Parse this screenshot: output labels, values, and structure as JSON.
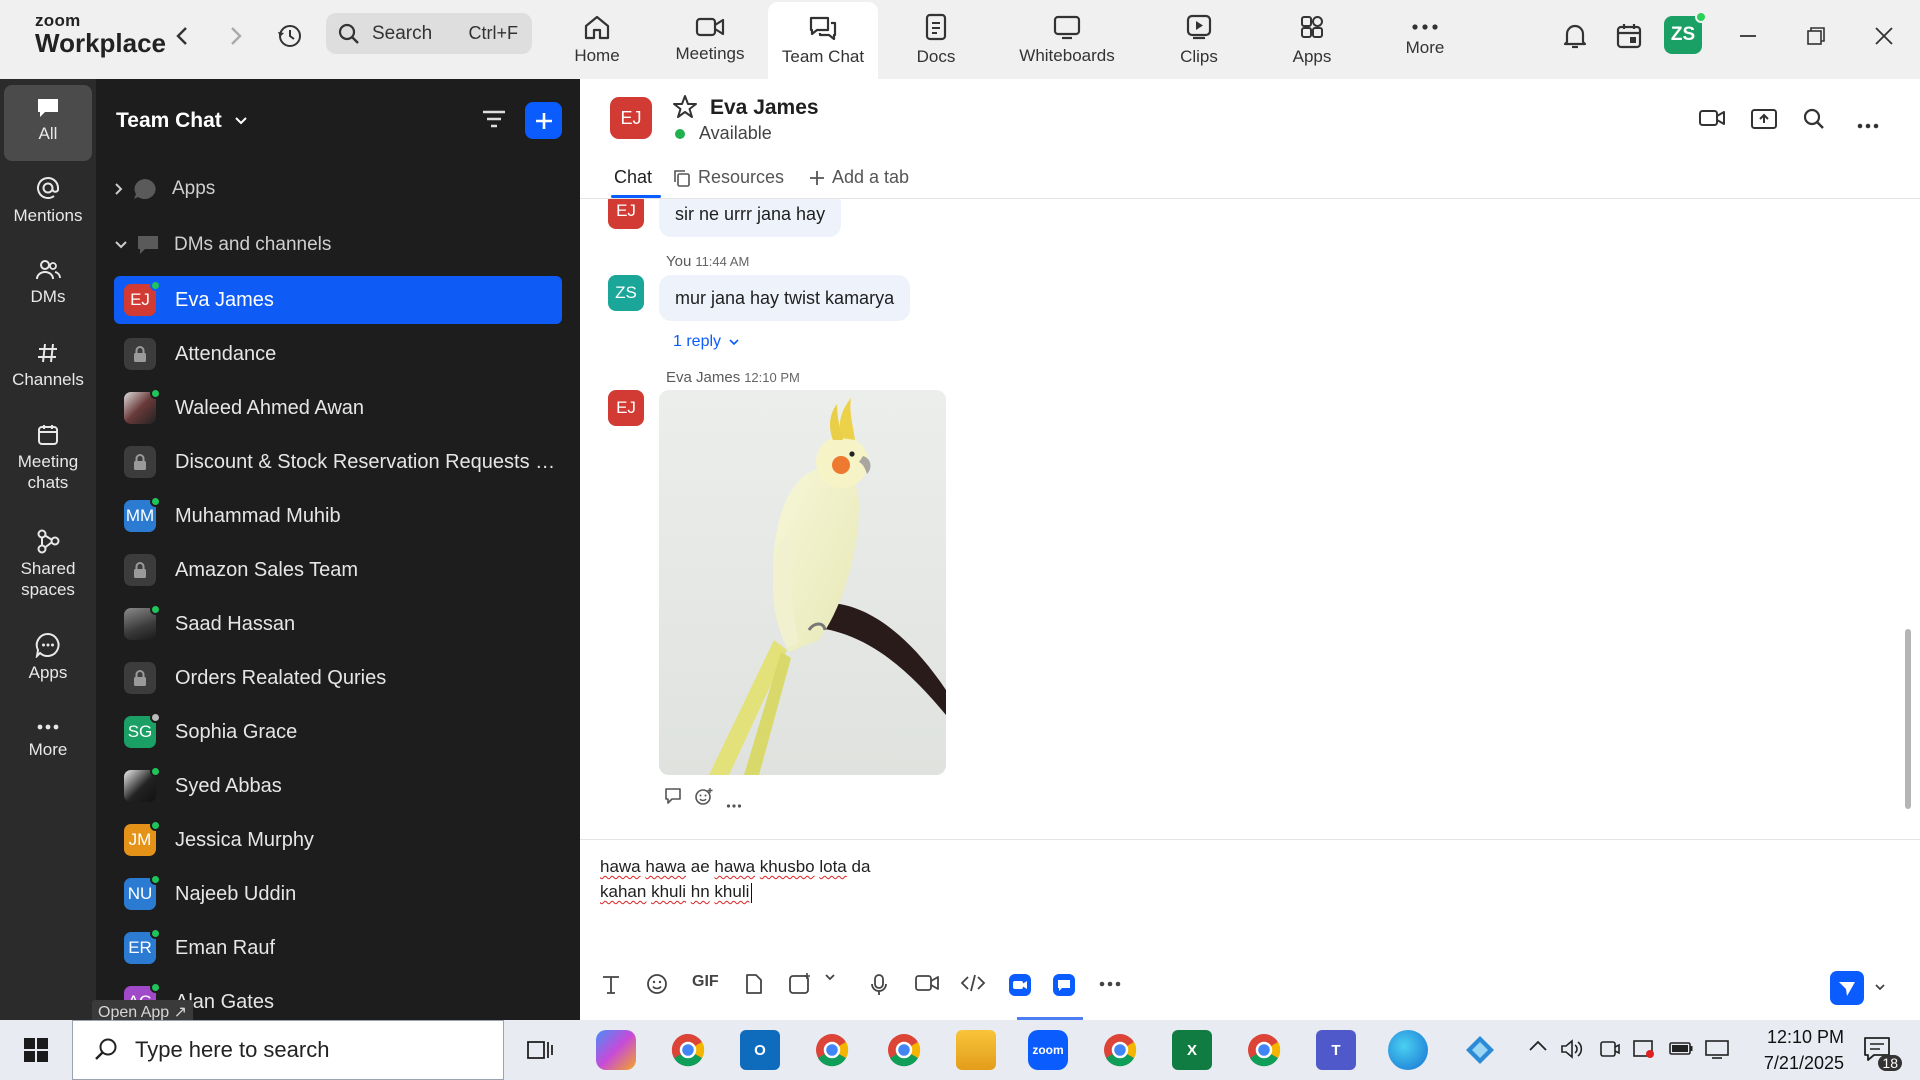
{
  "app": {
    "logo_top": "zoom",
    "logo_bottom": "Workplace"
  },
  "topbar": {
    "search_label": "Search",
    "search_shortcut": "Ctrl+F",
    "tabs": [
      {
        "label": "Home",
        "icon": "home-icon"
      },
      {
        "label": "Meetings",
        "icon": "video-icon"
      },
      {
        "label": "Team Chat",
        "icon": "chat-icon",
        "active": true
      },
      {
        "label": "Docs",
        "icon": "doc-icon"
      },
      {
        "label": "Whiteboards",
        "icon": "whiteboard-icon"
      },
      {
        "label": "Clips",
        "icon": "clips-icon"
      },
      {
        "label": "Apps",
        "icon": "apps-icon"
      },
      {
        "label": "More",
        "icon": "more-icon"
      }
    ],
    "user_initials": "ZS"
  },
  "rail": [
    {
      "label": "All",
      "icon": "chat-bubble-icon",
      "active": true
    },
    {
      "label": "Mentions",
      "icon": "at-icon"
    },
    {
      "label": "DMs",
      "icon": "people-icon"
    },
    {
      "label": "Channels",
      "icon": "hash-icon"
    },
    {
      "label_line1": "Meeting",
      "label_line2": "chats",
      "icon": "calendar-icon"
    },
    {
      "label_line1": "Shared",
      "label_line2": "spaces",
      "icon": "shared-icon"
    },
    {
      "label": "Apps",
      "icon": "apps-bubble-icon"
    },
    {
      "label": "More",
      "icon": "more-icon"
    }
  ],
  "sidebar": {
    "title": "Team Chat",
    "sections": {
      "apps": "Apps",
      "dms": "DMs and channels"
    },
    "items": [
      {
        "name": "Eva James",
        "initials": "EJ",
        "color": "#d13b33",
        "online": true,
        "active": true
      },
      {
        "name": "Attendance",
        "lock": true
      },
      {
        "name": "Waleed Ahmed Awan",
        "initials": "",
        "color": "#5a4a48",
        "online": true,
        "photo": true
      },
      {
        "name": "Discount & Stock Reservation Requests O...",
        "lock": true
      },
      {
        "name": "Muhammad Muhib",
        "initials": "MM",
        "color": "#2b7bd3",
        "online": true
      },
      {
        "name": "Amazon Sales Team",
        "lock": true
      },
      {
        "name": "Saad Hassan",
        "initials": "",
        "color": "#4a4a4a",
        "online": true,
        "photo": true
      },
      {
        "name": "Orders Realated Quries",
        "lock": true
      },
      {
        "name": "Sophia Grace",
        "initials": "SG",
        "color": "#1aa065",
        "away": true
      },
      {
        "name": "Syed Abbas",
        "initials": "",
        "color": "#333333",
        "online": true,
        "photo": true
      },
      {
        "name": "Jessica Murphy",
        "initials": "JM",
        "color": "#e59318",
        "online": true
      },
      {
        "name": "Najeeb Uddin",
        "initials": "NU",
        "color": "#2b7bd3",
        "online": true
      },
      {
        "name": "Eman Rauf",
        "initials": "ER",
        "color": "#2b7bd3",
        "online": true
      },
      {
        "name": "Alan Gates",
        "initials": "AG",
        "color": "#a04ac9",
        "online": true
      }
    ],
    "open_app": "Open App ↗"
  },
  "chat": {
    "contact_name": "Eva James",
    "contact_initials": "EJ",
    "status": "Available",
    "tabs": {
      "chat": "Chat",
      "resources": "Resources",
      "add": "Add a tab"
    },
    "messages": [
      {
        "sender_initials": "EJ",
        "text": "sir ne urrr jana hay"
      },
      {
        "sender": "You",
        "time": "11:44 AM",
        "sender_initials": "ZS",
        "text": "mur jana hay twist kamarya",
        "replies": "1 reply"
      },
      {
        "sender": "Eva James",
        "time": "12:10 PM",
        "sender_initials": "EJ",
        "image": "cockatiel-photo"
      }
    ],
    "composer": {
      "line1_words": [
        "hawa",
        "hawa",
        "ae",
        "hawa",
        "khusbo",
        "lota",
        "da"
      ],
      "line2_words": [
        "kahan",
        "khuli",
        "hn",
        "khuli"
      ]
    }
  },
  "taskbar": {
    "search_placeholder": "Type here to search",
    "time": "12:10 PM",
    "date": "7/21/2025",
    "notifications": "18"
  },
  "colors": {
    "accent": "#0b5cff",
    "online": "#1fc55a",
    "sidebar_bg": "#1d1d1d",
    "rail_bg": "#2b2b2b"
  }
}
